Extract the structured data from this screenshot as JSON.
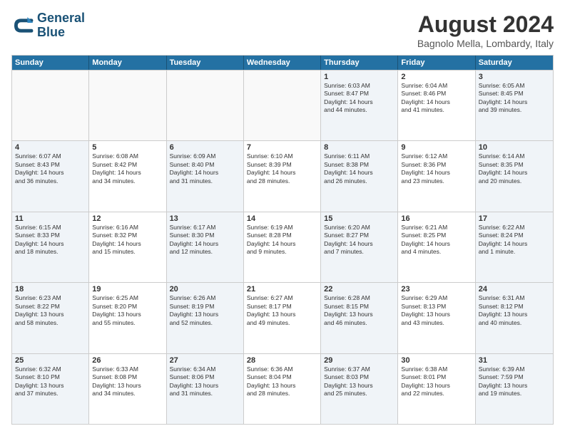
{
  "logo": {
    "line1": "General",
    "line2": "Blue"
  },
  "title": "August 2024",
  "location": "Bagnolo Mella, Lombardy, Italy",
  "headers": [
    "Sunday",
    "Monday",
    "Tuesday",
    "Wednesday",
    "Thursday",
    "Friday",
    "Saturday"
  ],
  "rows": [
    [
      {
        "day": "",
        "detail": "",
        "empty": true
      },
      {
        "day": "",
        "detail": "",
        "empty": true
      },
      {
        "day": "",
        "detail": "",
        "empty": true
      },
      {
        "day": "",
        "detail": "",
        "empty": true
      },
      {
        "day": "1",
        "detail": "Sunrise: 6:03 AM\nSunset: 8:47 PM\nDaylight: 14 hours\nand 44 minutes.",
        "empty": false
      },
      {
        "day": "2",
        "detail": "Sunrise: 6:04 AM\nSunset: 8:46 PM\nDaylight: 14 hours\nand 41 minutes.",
        "empty": false
      },
      {
        "day": "3",
        "detail": "Sunrise: 6:05 AM\nSunset: 8:45 PM\nDaylight: 14 hours\nand 39 minutes.",
        "empty": false
      }
    ],
    [
      {
        "day": "4",
        "detail": "Sunrise: 6:07 AM\nSunset: 8:43 PM\nDaylight: 14 hours\nand 36 minutes.",
        "empty": false
      },
      {
        "day": "5",
        "detail": "Sunrise: 6:08 AM\nSunset: 8:42 PM\nDaylight: 14 hours\nand 34 minutes.",
        "empty": false
      },
      {
        "day": "6",
        "detail": "Sunrise: 6:09 AM\nSunset: 8:40 PM\nDaylight: 14 hours\nand 31 minutes.",
        "empty": false
      },
      {
        "day": "7",
        "detail": "Sunrise: 6:10 AM\nSunset: 8:39 PM\nDaylight: 14 hours\nand 28 minutes.",
        "empty": false
      },
      {
        "day": "8",
        "detail": "Sunrise: 6:11 AM\nSunset: 8:38 PM\nDaylight: 14 hours\nand 26 minutes.",
        "empty": false
      },
      {
        "day": "9",
        "detail": "Sunrise: 6:12 AM\nSunset: 8:36 PM\nDaylight: 14 hours\nand 23 minutes.",
        "empty": false
      },
      {
        "day": "10",
        "detail": "Sunrise: 6:14 AM\nSunset: 8:35 PM\nDaylight: 14 hours\nand 20 minutes.",
        "empty": false
      }
    ],
    [
      {
        "day": "11",
        "detail": "Sunrise: 6:15 AM\nSunset: 8:33 PM\nDaylight: 14 hours\nand 18 minutes.",
        "empty": false
      },
      {
        "day": "12",
        "detail": "Sunrise: 6:16 AM\nSunset: 8:32 PM\nDaylight: 14 hours\nand 15 minutes.",
        "empty": false
      },
      {
        "day": "13",
        "detail": "Sunrise: 6:17 AM\nSunset: 8:30 PM\nDaylight: 14 hours\nand 12 minutes.",
        "empty": false
      },
      {
        "day": "14",
        "detail": "Sunrise: 6:19 AM\nSunset: 8:28 PM\nDaylight: 14 hours\nand 9 minutes.",
        "empty": false
      },
      {
        "day": "15",
        "detail": "Sunrise: 6:20 AM\nSunset: 8:27 PM\nDaylight: 14 hours\nand 7 minutes.",
        "empty": false
      },
      {
        "day": "16",
        "detail": "Sunrise: 6:21 AM\nSunset: 8:25 PM\nDaylight: 14 hours\nand 4 minutes.",
        "empty": false
      },
      {
        "day": "17",
        "detail": "Sunrise: 6:22 AM\nSunset: 8:24 PM\nDaylight: 14 hours\nand 1 minute.",
        "empty": false
      }
    ],
    [
      {
        "day": "18",
        "detail": "Sunrise: 6:23 AM\nSunset: 8:22 PM\nDaylight: 13 hours\nand 58 minutes.",
        "empty": false
      },
      {
        "day": "19",
        "detail": "Sunrise: 6:25 AM\nSunset: 8:20 PM\nDaylight: 13 hours\nand 55 minutes.",
        "empty": false
      },
      {
        "day": "20",
        "detail": "Sunrise: 6:26 AM\nSunset: 8:19 PM\nDaylight: 13 hours\nand 52 minutes.",
        "empty": false
      },
      {
        "day": "21",
        "detail": "Sunrise: 6:27 AM\nSunset: 8:17 PM\nDaylight: 13 hours\nand 49 minutes.",
        "empty": false
      },
      {
        "day": "22",
        "detail": "Sunrise: 6:28 AM\nSunset: 8:15 PM\nDaylight: 13 hours\nand 46 minutes.",
        "empty": false
      },
      {
        "day": "23",
        "detail": "Sunrise: 6:29 AM\nSunset: 8:13 PM\nDaylight: 13 hours\nand 43 minutes.",
        "empty": false
      },
      {
        "day": "24",
        "detail": "Sunrise: 6:31 AM\nSunset: 8:12 PM\nDaylight: 13 hours\nand 40 minutes.",
        "empty": false
      }
    ],
    [
      {
        "day": "25",
        "detail": "Sunrise: 6:32 AM\nSunset: 8:10 PM\nDaylight: 13 hours\nand 37 minutes.",
        "empty": false
      },
      {
        "day": "26",
        "detail": "Sunrise: 6:33 AM\nSunset: 8:08 PM\nDaylight: 13 hours\nand 34 minutes.",
        "empty": false
      },
      {
        "day": "27",
        "detail": "Sunrise: 6:34 AM\nSunset: 8:06 PM\nDaylight: 13 hours\nand 31 minutes.",
        "empty": false
      },
      {
        "day": "28",
        "detail": "Sunrise: 6:36 AM\nSunset: 8:04 PM\nDaylight: 13 hours\nand 28 minutes.",
        "empty": false
      },
      {
        "day": "29",
        "detail": "Sunrise: 6:37 AM\nSunset: 8:03 PM\nDaylight: 13 hours\nand 25 minutes.",
        "empty": false
      },
      {
        "day": "30",
        "detail": "Sunrise: 6:38 AM\nSunset: 8:01 PM\nDaylight: 13 hours\nand 22 minutes.",
        "empty": false
      },
      {
        "day": "31",
        "detail": "Sunrise: 6:39 AM\nSunset: 7:59 PM\nDaylight: 13 hours\nand 19 minutes.",
        "empty": false
      }
    ]
  ]
}
